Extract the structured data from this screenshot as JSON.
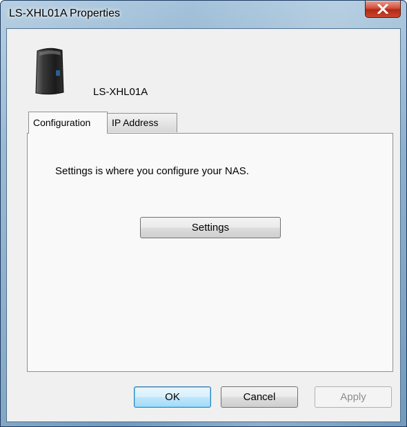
{
  "window": {
    "title": "LS-XHL01A Properties"
  },
  "device": {
    "name": "LS-XHL01A",
    "icon": "nas-drive-icon"
  },
  "tabs": [
    {
      "label": "Configuration",
      "selected": true
    },
    {
      "label": "IP Address",
      "selected": false
    }
  ],
  "panel": {
    "description": "Settings is where you configure your NAS.",
    "settings_button": "Settings"
  },
  "footer": {
    "ok_label": "OK",
    "cancel_label": "Cancel",
    "apply_label": "Apply",
    "apply_enabled": false
  },
  "colors": {
    "close_button": "#c8442e",
    "dialog_background": "#f0f0f0",
    "default_button_border": "#3c7fb1"
  }
}
